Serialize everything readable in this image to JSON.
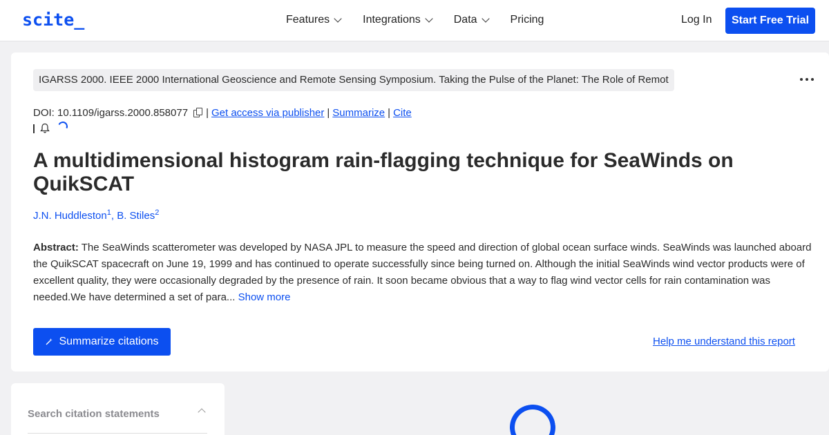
{
  "brand": {
    "logo": "scite_",
    "accent": "#0c4ff0"
  },
  "nav": {
    "items": [
      {
        "label": "Features",
        "icon": "chevron-down-icon"
      },
      {
        "label": "Integrations",
        "icon": "chevron-down-icon"
      },
      {
        "label": "Data",
        "icon": "chevron-down-icon"
      },
      {
        "label": "Pricing"
      }
    ],
    "login": "Log In",
    "trial": "Start Free Trial"
  },
  "paper": {
    "venue": "IGARSS 2000. IEEE 2000 International Geoscience and Remote Sensing Symposium. Taking the Pulse of the Planet: The Role of Remot",
    "doi": "DOI: 10.1109/igarss.2000.858077",
    "links": {
      "access": "Get access via publisher",
      "summarize": "Summarize",
      "cite": "Cite"
    },
    "title": "A multidimensional histogram rain-flagging technique for SeaWinds on QuikSCAT",
    "authors": [
      {
        "name": "J.N. Huddleston",
        "sup": "1"
      },
      {
        "name": "B. Stiles",
        "sup": "2"
      }
    ],
    "author_separator": ", ",
    "abstract_label": "Abstract:",
    "abstract_text": " The SeaWinds scatterometer was developed by NASA JPL to measure the speed and direction of global ocean surface winds. SeaWinds was launched aboard the QuikSCAT spacecraft on June 19, 1999 and has continued to operate successfully since being turned on. Although the initial SeaWinds wind vector products were of excellent quality, they were occasionally degraded by the presence of rain. It soon became obvious that a way to flag wind vector cells for rain contamination was needed.We have determined a set of para... ",
    "show_more": "Show more"
  },
  "actions": {
    "summarize_citations": "Summarize citations",
    "help": "Help me understand this report"
  },
  "sidebar": {
    "search_label": "Search citation statements"
  }
}
